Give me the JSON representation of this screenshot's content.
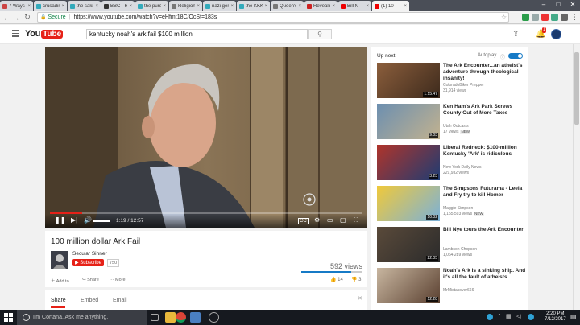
{
  "browser": {
    "tabs": [
      {
        "label": "7 Ways",
        "color": "#c44"
      },
      {
        "label": "crusadin",
        "color": "#3ab"
      },
      {
        "label": "the saki",
        "color": "#3ab"
      },
      {
        "label": "BBC - Re",
        "color": "#333"
      },
      {
        "label": "the pure",
        "color": "#3ab"
      },
      {
        "label": "Religion",
        "color": "#777"
      },
      {
        "label": "nazi gen",
        "color": "#3ab"
      },
      {
        "label": "the KKK",
        "color": "#3ab"
      },
      {
        "label": "Queen's",
        "color": "#777"
      },
      {
        "label": "Revealing",
        "color": "#c22"
      },
      {
        "label": "Bill N",
        "color": "#e00"
      },
      {
        "label": "(1) 10",
        "color": "#e00",
        "active": true
      }
    ],
    "secure_label": "Secure",
    "url": "https://www.youtube.com/watch?v=eHfmt18C/OcSt=183s",
    "window_controls": {
      "minimize": "–",
      "maximize": "□",
      "close": "✕"
    }
  },
  "youtube": {
    "logo_you": "You",
    "logo_tube": "Tube",
    "search_query": "kentucky noah's ark fail $100 million",
    "notification_count": "1"
  },
  "player": {
    "time_current": "1:19",
    "time_separator": "/",
    "time_total": "12:57",
    "progress_fraction": 0.102
  },
  "video": {
    "title": "100 million dollar Ark Fail",
    "channel": "Secular Sinner",
    "subscribe_label": "Subscribe",
    "subscriber_count": "750",
    "views": "592 views",
    "add_to": "Add to",
    "share": "Share",
    "more": "More",
    "likes": "14",
    "dislikes": "3",
    "like_fraction": 0.82
  },
  "lower_tabs": {
    "share": "Share",
    "embed": "Embed",
    "email": "Email"
  },
  "sidebar": {
    "up_next": "Up next",
    "autoplay": "Autoplay",
    "recommendations": [
      {
        "title": "The Ark Encounter...an atheist's adventure through theological insanity!",
        "channel": "ColoradoBiker Prepper",
        "views": "31,914 views",
        "duration": "1:15:47",
        "new": ""
      },
      {
        "title": "Ken Ham's Ark Park Screws County Out of More Taxes",
        "channel": "Utah Outcasts",
        "views": "17 views",
        "duration": "9:03",
        "new": "NEW"
      },
      {
        "title": "Liberal Redneck: $100-million Kentucky 'Ark' is ridiculous",
        "channel": "New York Daily News",
        "views": "229,932 views",
        "duration": "3:23",
        "new": ""
      },
      {
        "title": "The Simpsons Futurama - Leela and Fry try to kill Homer",
        "channel": "Maggie Simpson",
        "views": "1,155,593 views",
        "duration": "10:02",
        "new": "NEW"
      },
      {
        "title": "Bill Nye tours the Ark Encounter",
        "channel": "Lambson Chopson",
        "views": "1,064,289 views",
        "duration": "22:05",
        "new": ""
      },
      {
        "title": "Noah's Ark is a sinking ship. And it's all the fault of atheists.",
        "channel": "MrMistakover666",
        "views": "",
        "duration": "12:28",
        "new": ""
      }
    ]
  },
  "taskbar": {
    "cortana_prompt": "I'm Cortana. Ask me anything.",
    "time": "2:20 PM",
    "date": "7/12/2017"
  }
}
